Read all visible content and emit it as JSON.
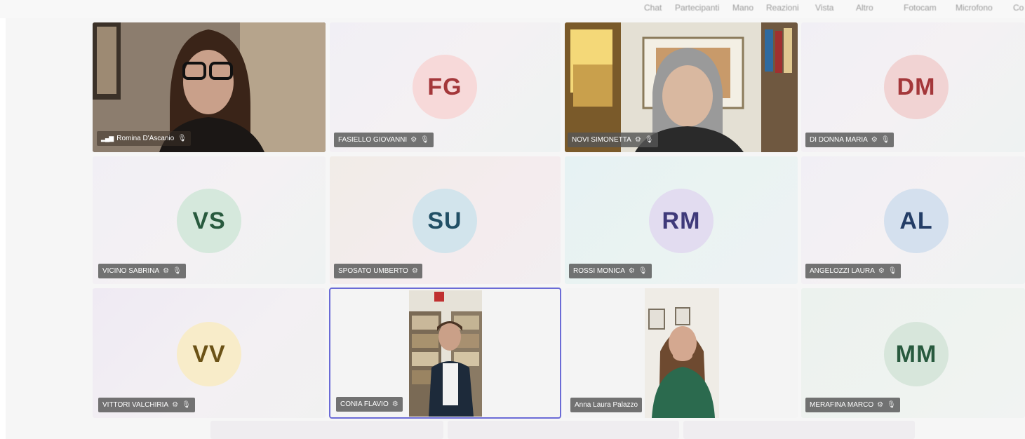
{
  "toolbar": {
    "items": [
      "Chat",
      "Partecipanti",
      "Mano",
      "Reazioni",
      "Vista",
      "Altro",
      "Fotocam",
      "Microfono",
      "Co"
    ]
  },
  "tiles": [
    {
      "name": "Romina D'Ascanio",
      "type": "video",
      "signal_icon": "signal-bars-icon",
      "mic_icon": "mic-off-icon"
    },
    {
      "name": "FASIELLO GIOVANNI",
      "type": "avatar",
      "initials": "FG",
      "avatar_bg": "#f7d9d9",
      "initials_color": "#a4373a"
    },
    {
      "name": "NOVI SIMONETTA",
      "type": "video"
    },
    {
      "name": "DI DONNA MARIA",
      "type": "avatar",
      "initials": "DM",
      "avatar_bg": "#f1d3d3",
      "initials_color": "#a4373a"
    },
    {
      "name": "VICINO SABRINA",
      "type": "avatar",
      "initials": "VS",
      "avatar_bg": "#d5e8dc",
      "initials_color": "#285a3e"
    },
    {
      "name": "SPOSATO UMBERTO",
      "type": "avatar",
      "initials": "SU",
      "avatar_bg": "#d2e4ec",
      "initials_color": "#214f65"
    },
    {
      "name": "ROSSI MONICA",
      "type": "avatar",
      "initials": "RM",
      "avatar_bg": "#e2dcf0",
      "initials_color": "#3f3a7a"
    },
    {
      "name": "ANGELOZZI LAURA",
      "type": "avatar",
      "initials": "AL",
      "avatar_bg": "#d4e0ee",
      "initials_color": "#233d66"
    },
    {
      "name": "VITTORI VALCHIRIA",
      "type": "avatar",
      "initials": "VV",
      "avatar_bg": "#f8ecc9",
      "initials_color": "#6b5216"
    },
    {
      "name": "CONIA FLAVIO",
      "type": "video",
      "active_speaker": true
    },
    {
      "name": "Anna Laura Palazzo",
      "type": "video"
    },
    {
      "name": "MERAFINA MARCO",
      "type": "avatar",
      "initials": "MM",
      "avatar_bg": "#d7e6db",
      "initials_color": "#285a3e"
    }
  ],
  "colors": {
    "active_speaker_border": "#6b6bd6",
    "name_tag_bg": "#555555"
  }
}
